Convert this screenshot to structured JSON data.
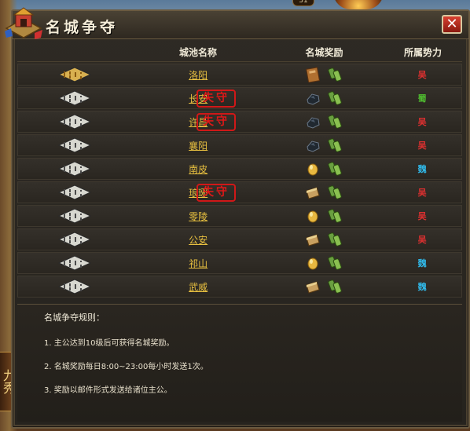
{
  "window": {
    "title": "名城争夺",
    "close_label": "✕",
    "top_badge": "31"
  },
  "side_tab": "九秀",
  "table": {
    "headers": [
      "城池名称",
      "名城奖励",
      "所属势力"
    ],
    "rows": [
      {
        "city": "洛阳",
        "fort": "gold",
        "lost": false,
        "reward": "book",
        "faction": "吴",
        "faction_color": "#e03030"
      },
      {
        "city": "长安",
        "fort": "white",
        "lost": true,
        "reward": "ore",
        "faction": "蜀",
        "faction_color": "#50c030"
      },
      {
        "city": "许昌",
        "fort": "white",
        "lost": true,
        "reward": "ore",
        "faction": "吴",
        "faction_color": "#e03030"
      },
      {
        "city": "襄阳",
        "fort": "white",
        "lost": false,
        "reward": "ore",
        "faction": "吴",
        "faction_color": "#e03030"
      },
      {
        "city": "南皮",
        "fort": "white",
        "lost": false,
        "reward": "egg",
        "faction": "魏",
        "faction_color": "#30b8e8"
      },
      {
        "city": "琅琊",
        "fort": "white",
        "lost": true,
        "reward": "plank",
        "faction": "吴",
        "faction_color": "#e03030"
      },
      {
        "city": "零陵",
        "fort": "white",
        "lost": false,
        "reward": "egg",
        "faction": "吴",
        "faction_color": "#e03030"
      },
      {
        "city": "公安",
        "fort": "white",
        "lost": false,
        "reward": "plank",
        "faction": "吴",
        "faction_color": "#e03030"
      },
      {
        "city": "祁山",
        "fort": "white",
        "lost": false,
        "reward": "egg",
        "faction": "魏",
        "faction_color": "#30b8e8"
      },
      {
        "city": "武威",
        "fort": "white",
        "lost": false,
        "reward": "plank",
        "faction": "魏",
        "faction_color": "#30b8e8"
      }
    ],
    "lost_stamp": "失守"
  },
  "rules": {
    "title": "名城争夺规则：",
    "lines": [
      "1. 主公达到10级后可获得名城奖励。",
      "2. 名城奖励每日8:00~23:00每小时发送1次。",
      "3. 奖励以邮件形式发送给诸位主公。"
    ]
  }
}
